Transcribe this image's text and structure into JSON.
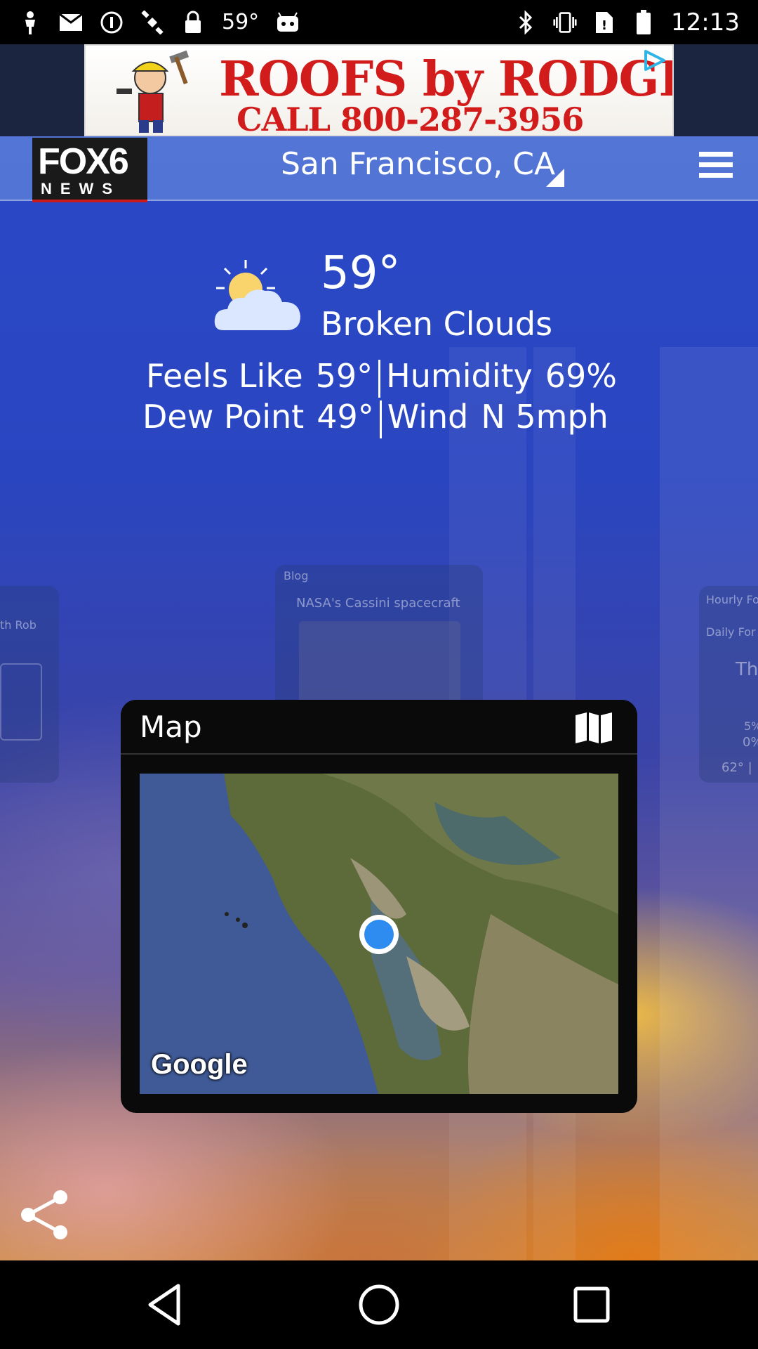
{
  "status_bar": {
    "temperature": "59°",
    "time": "12:13",
    "icons": [
      "person-icon",
      "gmail-icon",
      "info-icon",
      "satellite-icon",
      "lock-icon",
      "android-icon",
      "bluetooth-icon",
      "vibrate-icon",
      "no-sim-icon",
      "battery-icon"
    ]
  },
  "ad": {
    "title": "ROOFS by RODGER",
    "phone": "CALL 800-287-3956"
  },
  "header": {
    "logo_top": "FOX6",
    "logo_bottom": "NEWS",
    "location": "San Francisco, CA"
  },
  "current": {
    "temperature": "59°",
    "condition": "Broken Clouds",
    "feels_like_label": "Feels Like",
    "feels_like_value": "59°",
    "humidity_label": "Humidity",
    "humidity_value": "69%",
    "dew_point_label": "Dew Point",
    "dew_point_value": "49°",
    "wind_label": "Wind",
    "wind_value": "N 5mph"
  },
  "background_cards": {
    "blog_label": "Blog",
    "blog_text": "NASA's Cassini spacecraft",
    "left_text": "th Rob",
    "right_label_1": "Hourly Fo",
    "right_label_2": "Daily For",
    "right_day": "Th",
    "right_pct_1": "5%",
    "right_pct_2": "0%",
    "right_temp": "62° |"
  },
  "map_card": {
    "title": "Map",
    "attribution": "Google"
  },
  "colors": {
    "sky_blue": "#2a49c8",
    "card_black": "#0a0a0a",
    "location_dot": "#2e8bf0",
    "ad_red": "#d21c1c"
  }
}
